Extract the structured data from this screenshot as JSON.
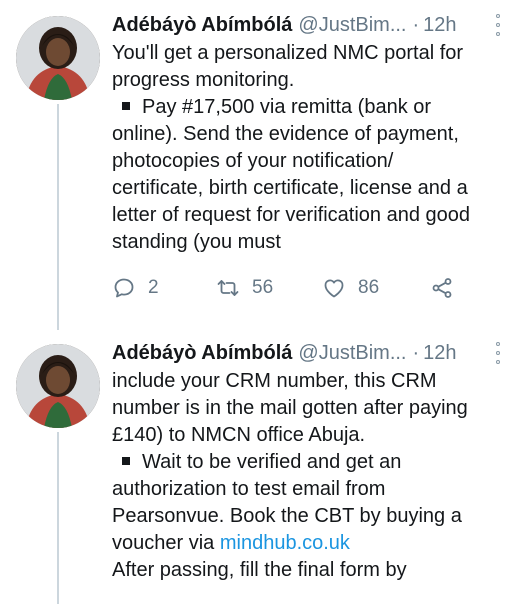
{
  "tweets": [
    {
      "author_name": "Adébáyò Abímbólá",
      "handle": "@JustBim...",
      "separator": "·",
      "time": "12h",
      "lines": [
        {
          "text": "You'll get a personalized NMC portal for"
        },
        {
          "text": "progress monitoring."
        },
        {
          "text": "Pay #17,500 via remitta (bank or",
          "bullet": true
        },
        {
          "text": "online). Send the evidence of payment,"
        },
        {
          "text": "photocopies of your notification/"
        },
        {
          "text": "certificate, birth certificate, license and a"
        },
        {
          "text": "letter of request for verification and good"
        },
        {
          "text": "standing (you must"
        }
      ],
      "replies": "2",
      "retweets": "56",
      "likes": "86"
    },
    {
      "author_name": "Adébáyò Abímbólá",
      "handle": "@JustBim...",
      "separator": "·",
      "time": "12h",
      "lines": [
        {
          "text": "include your CRM number, this CRM"
        },
        {
          "text": "number is in the mail gotten after paying"
        },
        {
          "text": "£140) to NMCN office Abuja."
        },
        {
          "text": "Wait to be verified and get an",
          "bullet": true
        },
        {
          "text": "authorization to test email from"
        },
        {
          "text": "Pearsonvue. Book the CBT by buying a"
        },
        {
          "text": "voucher via ",
          "link": "mindhub.co.uk"
        },
        {
          "text": "After passing, fill the final form by"
        }
      ]
    }
  ],
  "colors": {
    "text": "#14171a",
    "secondary": "#657786",
    "link": "#1b95e0",
    "thread_line": "#ccd6dd"
  },
  "icons": {
    "reply": "reply-icon",
    "retweet": "retweet-icon",
    "like": "heart-icon",
    "share": "share-icon",
    "more": "more-vertical-icon"
  }
}
